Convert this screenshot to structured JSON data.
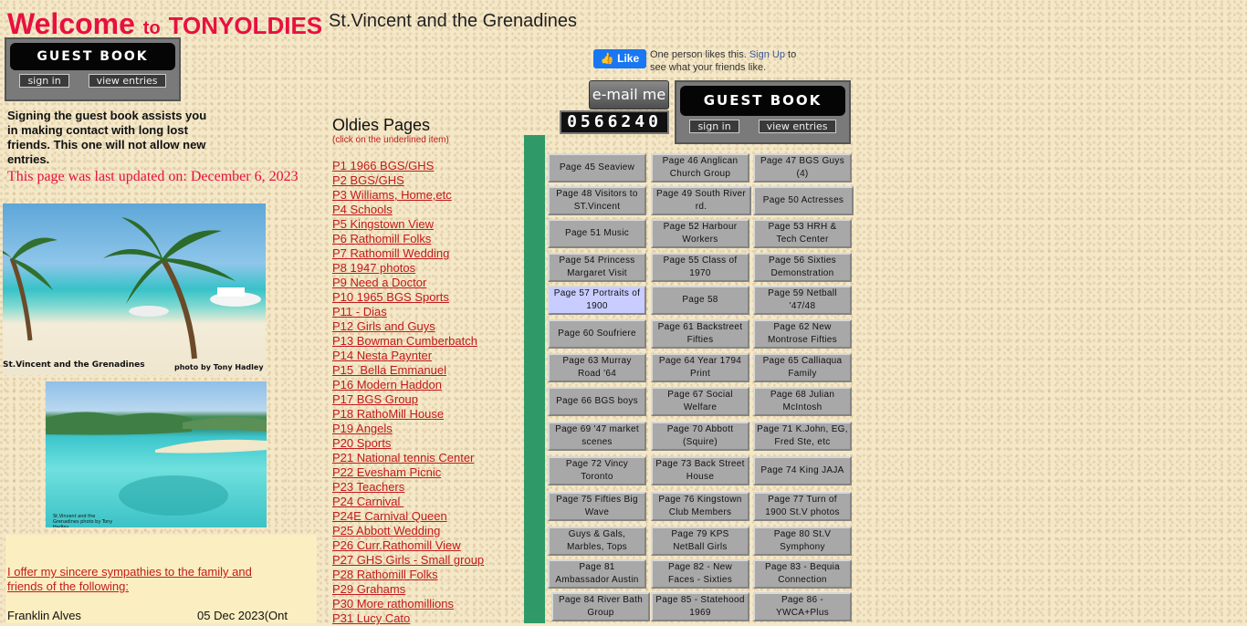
{
  "header": {
    "welcome": "Welcome",
    "to": "to",
    "site": "TONYOLDIES",
    "location": "St.Vincent and the Grenadines"
  },
  "guestbook": {
    "title": "GUEST BOOK",
    "sign_in": "sign in",
    "view_entries": "view entries"
  },
  "intro_text": "Signing the guest book assists you in making contact with long lost friends.  This one will not allow new entries.",
  "updated_text": "This page was last updated on: December 6, 2023",
  "photos": {
    "photo1_caption_left": "St.Vincent and the Grenadines",
    "photo1_caption_right": "photo by Tony Hadley",
    "photo2_caption": "St.Vincent and the Grenadines photo by Tony Hadley"
  },
  "sympathy": {
    "text": "I offer my sincere sympathies to the family and friends of the following:",
    "name": "Franklin Alves",
    "date": "05 Dec 2023(Ont"
  },
  "oldies": {
    "title": "Oldies Pages",
    "subtitle": "(click on the underlined item)",
    "items": [
      "P1 1966 BGS/GHS",
      "P2 BGS/GHS",
      "P3 Williams, Home,etc",
      "P4 Schools",
      "P5 Kingstown View",
      "P6 Rathomill Folks",
      "P7 Rathomill Wedding",
      "P8 1947 photos",
      "P9 Need a Doctor",
      "P10 1965 BGS Sports",
      "P11 - Dias",
      "P12 Girls and Guys",
      "P13 Bowman Cumberbatch",
      "P14 Nesta Paynter",
      "P15  Bella Emmanuel",
      "P16 Modern Haddon",
      "P17 BGS Group",
      "P18 RathoMill House",
      "P19 Angels",
      "P20 Sports",
      "P21 National tennis Center",
      "P22 Evesham Picnic",
      "P23 Teachers",
      "P24 Carnival ",
      "P24E Carnival Queen",
      "P25 Abbott Wedding",
      "P26 Curr.Rathomill View",
      "P27 GHS Girls - Small group",
      "P28 Rathomill Folks",
      "P29 Grahams",
      "P30 More rathomillions",
      "P31 Lucy Cato"
    ]
  },
  "facebook": {
    "like": "Like",
    "text_pre": "One person likes this. ",
    "sign_up": "Sign Up",
    "text_post": " to see what your friends like."
  },
  "email_label": "e-mail me",
  "counter": "0566240",
  "page_buttons": [
    [
      "Page 45 Seaview",
      "Page 46 Anglican Church Group",
      "Page 47  BGS Guys (4)"
    ],
    [
      "Page 48 Visitors to ST.Vincent",
      "Page 49 South River rd.",
      "Page 50 Actresses"
    ],
    [
      "Page 51 Music",
      "Page 52 Harbour Workers",
      "Page 53 HRH & Tech Center"
    ],
    [
      "Page 54 Princess Margaret Visit",
      "Page 55 Class of 1970",
      "Page 56 Sixties Demonstration"
    ],
    [
      "Page 57 Portraits of 1900",
      "Page 58",
      "Page 59 Netball '47/48"
    ],
    [
      "Page 60 Soufriere",
      "Page  61 Backstreet Fifties",
      "Page  62 New Montrose Fifties"
    ],
    [
      "Page  63 Murray Road '64",
      "Page  64 Year 1794 Print",
      "Page  65 Calliaqua Family"
    ],
    [
      "Page  66 BGS boys",
      "Page  67 Social Welfare",
      "Page  68 Julian McIntosh"
    ],
    [
      "Page  69 '47 market scenes",
      "Page  70 Abbott (Squire)",
      "Page  71  K.John, EG, Fred Ste, etc"
    ],
    [
      "Page  72  Vincy Toronto",
      "Page  73 Back Street House",
      "Page  74 King JAJA"
    ],
    [
      "Page  75 Fifties Big Wave",
      "Page  76 Kingstown Club Members",
      "Page  77 Turn of 1900 St.V photos"
    ],
    [
      "Guys & Gals, Marbles, Tops",
      "Page  79 KPS NetBall Girls",
      "Page  80 St.V Symphony"
    ],
    [
      "Page  81 Ambassador Austin",
      "Page 82 - New Faces - Sixties",
      "Page 83  - Bequia Connection"
    ],
    [
      "Page 84 River Bath Group",
      "Page 85 - Statehood 1969",
      "Page 86 - YWCA+Plus"
    ]
  ]
}
